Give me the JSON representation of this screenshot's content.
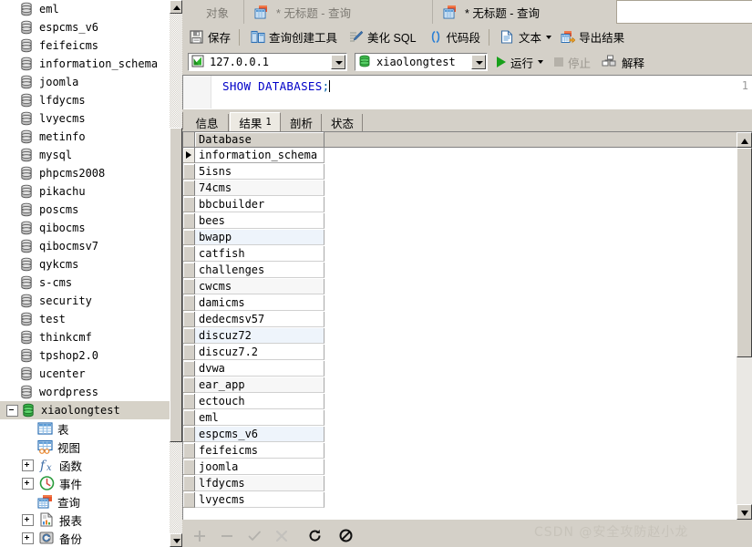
{
  "sidebar": {
    "databases": [
      "eml",
      "espcms_v6",
      "feifeicms",
      "information_schema",
      "joomla",
      "lfdycms",
      "lvyecms",
      "metinfo",
      "mysql",
      "phpcms2008",
      "pikachu",
      "poscms",
      "qibocms",
      "qibocmsv7",
      "qykcms",
      "s-cms",
      "security",
      "test",
      "thinkcmf",
      "tpshop2.0",
      "ucenter",
      "wordpress"
    ],
    "selected_db": "xiaolongtest",
    "children": [
      {
        "label": "表",
        "icon": "table-icon",
        "expandable": false
      },
      {
        "label": "视图",
        "icon": "view-icon",
        "expandable": false
      },
      {
        "label": "函数",
        "icon": "function-icon",
        "expandable": true
      },
      {
        "label": "事件",
        "icon": "event-icon",
        "expandable": true
      },
      {
        "label": "查询",
        "icon": "query-icon",
        "expandable": false
      },
      {
        "label": "报表",
        "icon": "report-icon",
        "expandable": true
      },
      {
        "label": "备份",
        "icon": "backup-icon",
        "expandable": true
      }
    ]
  },
  "tabs": {
    "object_tab": "对象",
    "query_tab_1": "* 无标题 - 查询",
    "query_tab_2": "* 无标题 - 查询"
  },
  "toolbar": {
    "save": "保存",
    "query_builder": "查询创建工具",
    "beautify_sql": "美化 SQL",
    "code_snippet": "代码段",
    "text": "文本",
    "export_result": "导出结果"
  },
  "connection": {
    "host": "127.0.0.1",
    "database": "xiaolongtest",
    "run": "运行",
    "stop": "停止",
    "explain": "解释"
  },
  "editor": {
    "line_number": "1",
    "sql_keyword": "SHOW DATABASES",
    "sql_terminator": ";"
  },
  "result_tabs": [
    {
      "label": "信息",
      "count": "",
      "active": false
    },
    {
      "label": "结果",
      "count": "1",
      "active": true
    },
    {
      "label": "剖析",
      "count": "",
      "active": false
    },
    {
      "label": "状态",
      "count": "",
      "active": false
    }
  ],
  "grid": {
    "column_header": "Database",
    "rows": [
      "information_schema",
      "5isns",
      "74cms",
      "bbcbuilder",
      "bees",
      "bwapp",
      "catfish",
      "challenges",
      "cwcms",
      "damicms",
      "dedecmsv57",
      "discuz72",
      "discuz7.2",
      "dvwa",
      "ear_app",
      "ectouch",
      "eml",
      "espcms_v6",
      "feifeicms",
      "joomla",
      "lfdycms",
      "lvyecms"
    ]
  },
  "status_bar": {
    "add": "add-record",
    "remove": "remove-record",
    "confirm": "confirm-record",
    "cancel": "cancel-record",
    "refresh": "refresh-records",
    "stop": "stop-loading"
  },
  "watermark": "CSDN @安全攻防赵小龙",
  "colors": {
    "chrome": "#d4d0c8",
    "accent_green": "#17a01a",
    "sql_text": "#0000c8",
    "grid_highlight": "#eef4fb",
    "selection": "#d6d2c8"
  }
}
